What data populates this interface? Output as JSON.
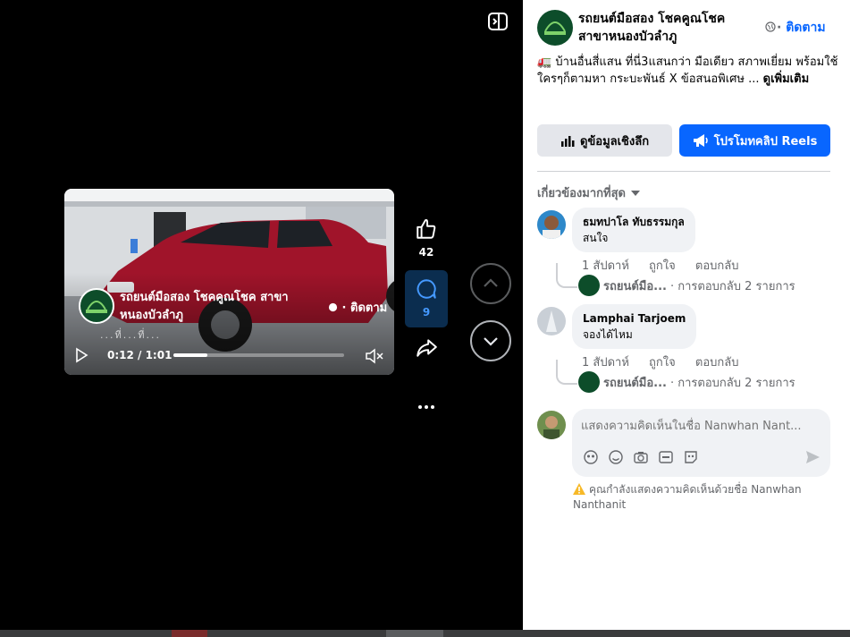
{
  "video": {
    "page_name": "รถยนต์มือสอง โชคคูณโชค สาขาหนองบัวลำภู",
    "follow": "· ติดตาม",
    "caption": "...ที่...ที่...",
    "time": "0:12 / 1:01",
    "progress": 0.2
  },
  "actions": {
    "likes": "42",
    "comments": "9"
  },
  "post": {
    "page_name": "รถยนต์มือสอง โชคคูณโชค สาขาหนองบัวลำภู",
    "follow": "ติดตาม",
    "description": "🚛 บ้านอื่นสี่แสน ที่นี่3แสนกว่า มือเดียว สภาพเยี่ยม พร้อมใช้ ใครๆก็ตามหา กระบะพันธ์ X ข้อสนอพิเศษ ...",
    "see_more": "ดูเพิ่มเติม",
    "insights_label": "ดูข้อมูลเชิงลึก",
    "promote_label": "โปรโมทคลิป Reels",
    "sort_label": "เกี่ยวข้องมากที่สุด"
  },
  "comments": [
    {
      "author": "ธมทปาโล ทับธรรมกุล",
      "text": "สนใจ",
      "time": "1 สัปดาห์",
      "like": "ถูกใจ",
      "reply": "ตอบกลับ",
      "reply_author": "รถยนต์มือ...",
      "reply_count": "· การตอบกลับ 2 รายการ"
    },
    {
      "author": "Lamphai Tarjoem",
      "text": "จองได้ไหม",
      "time": "1 สัปดาห์",
      "like": "ถูกใจ",
      "reply": "ตอบกลับ",
      "reply_author": "รถยนต์มือ...",
      "reply_count": "· การตอบกลับ 2 รายการ"
    }
  ],
  "composer": {
    "placeholder": "แสดงความคิดเห็นในชื่อ Nanwhan Nant...",
    "warning": "คุณกำลังแสดงความคิดเห็นด้วยชื่อ Nanwhan Nanthanit"
  },
  "colors": {
    "brand_blue": "#0866ff",
    "page_avatar_green": "#0d4d2a",
    "car_red": "#a0142a"
  },
  "icons": [
    "toggle-panel-icon",
    "thumbs-up-icon",
    "comment-icon",
    "share-icon",
    "more-icon",
    "chevron-up-icon",
    "chevron-down-icon",
    "globe-icon",
    "chart-icon",
    "megaphone-icon",
    "sticker-icon",
    "emoji-icon",
    "camera-icon",
    "gif-icon",
    "send-icon",
    "warning-icon"
  ]
}
